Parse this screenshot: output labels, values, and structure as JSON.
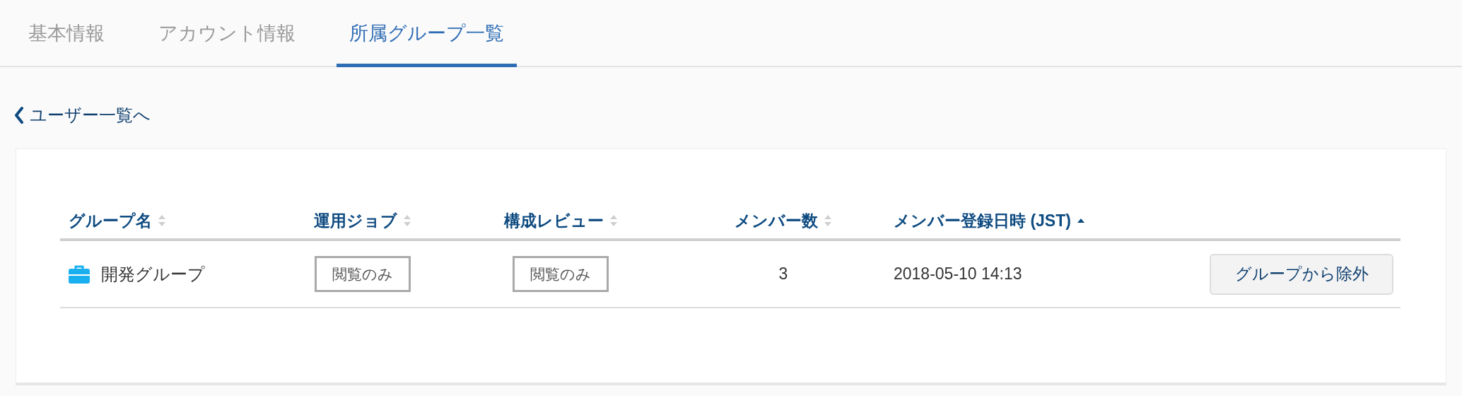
{
  "tabs": [
    {
      "label": "基本情報",
      "selected": false
    },
    {
      "label": "アカウント情報",
      "selected": false
    },
    {
      "label": "所属グループ一覧",
      "selected": true
    }
  ],
  "back_link": {
    "label": "ユーザー一覧へ"
  },
  "table": {
    "columns": [
      {
        "label": "グループ名",
        "sort_active": false
      },
      {
        "label": "運用ジョブ",
        "sort_active": false
      },
      {
        "label": "構成レビュー",
        "sort_active": false
      },
      {
        "label": "メンバー数",
        "sort_active": false
      },
      {
        "label": "メンバー登録日時 (JST)",
        "sort_active": true
      }
    ],
    "rows": [
      {
        "group": "開発グループ",
        "job_permission": "閲覧のみ",
        "review_permission": "閲覧のみ",
        "members": "3",
        "registered": "2018-05-10 14:13",
        "action": "グループから除外"
      }
    ]
  }
}
